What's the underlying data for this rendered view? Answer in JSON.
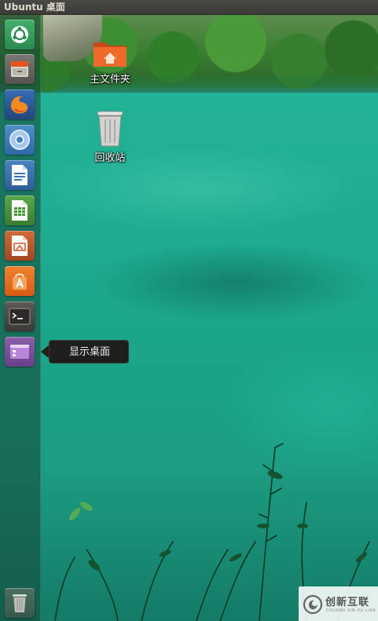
{
  "top_panel": {
    "title": "Ubuntu 桌面"
  },
  "launcher": {
    "items": [
      {
        "name": "dash-home",
        "icon": "ubuntu-logo-icon"
      },
      {
        "name": "files",
        "icon": "file-cabinet-icon"
      },
      {
        "name": "firefox",
        "icon": "firefox-icon"
      },
      {
        "name": "chromium",
        "icon": "chromium-icon"
      },
      {
        "name": "libreoffice-writer",
        "icon": "writer-document-icon"
      },
      {
        "name": "libreoffice-calc",
        "icon": "calc-spreadsheet-icon"
      },
      {
        "name": "libreoffice-impress",
        "icon": "impress-presentation-icon"
      },
      {
        "name": "software-center",
        "icon": "shopping-bag-icon"
      },
      {
        "name": "terminal",
        "icon": "terminal-icon"
      },
      {
        "name": "show-desktop",
        "icon": "show-desktop-icon"
      },
      {
        "name": "trash",
        "icon": "trash-icon"
      }
    ],
    "tooltip": "显示桌面"
  },
  "desktop": {
    "icons": [
      {
        "label": "主文件夹",
        "icon": "home-folder-icon"
      },
      {
        "label": "回收站",
        "icon": "trash-icon"
      }
    ]
  },
  "watermark": {
    "cn": "创新互联",
    "en": "CHUANG XIN HU LIAN"
  },
  "colors": {
    "panel": "#3c3b37",
    "water": "#1fae93",
    "ubuntu_orange": "#e95420"
  }
}
